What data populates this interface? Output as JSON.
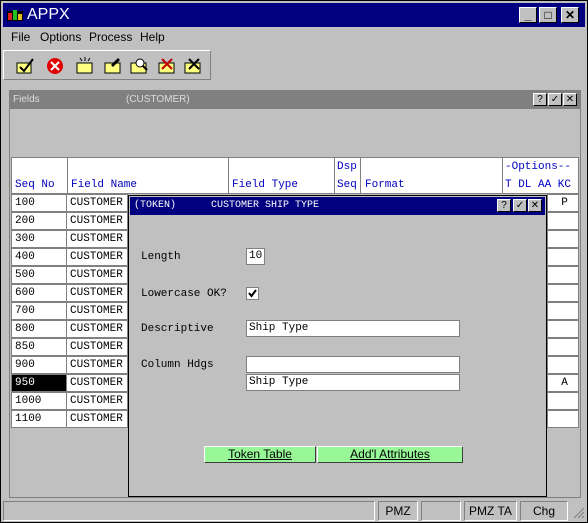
{
  "app": {
    "title": "APPX"
  },
  "menu": {
    "items": [
      "File",
      "Options",
      "Process",
      "Help"
    ]
  },
  "window_buttons": {
    "minimize": "_",
    "maximize": "□",
    "close": "✕"
  },
  "fields_window": {
    "title": "Fields",
    "subtitle": "(CUSTOMER)"
  },
  "table": {
    "headers": {
      "seq_no": "Seq No",
      "field_name": "Field Name",
      "field_type": "Field Type",
      "dsp": "Dsp",
      "seq": "Seq",
      "format": "Format",
      "options": "-Options--",
      "opt_cols": "T DL AA KC"
    },
    "rows": [
      {
        "seq": "100",
        "name": "CUSTOMER",
        "opt": "P"
      },
      {
        "seq": "200",
        "name": "CUSTOMER",
        "opt": ""
      },
      {
        "seq": "300",
        "name": "CUSTOMER",
        "opt": ""
      },
      {
        "seq": "400",
        "name": "CUSTOMER",
        "opt": ""
      },
      {
        "seq": "500",
        "name": "CUSTOMER",
        "opt": ""
      },
      {
        "seq": "600",
        "name": "CUSTOMER",
        "opt": ""
      },
      {
        "seq": "700",
        "name": "CUSTOMER",
        "opt": ""
      },
      {
        "seq": "800",
        "name": "CUSTOMER",
        "opt": ""
      },
      {
        "seq": "850",
        "name": "CUSTOMER",
        "opt": ""
      },
      {
        "seq": "900",
        "name": "CUSTOMER",
        "opt": ""
      },
      {
        "seq": "950",
        "name": "CUSTOMER",
        "opt": "A"
      },
      {
        "seq": "1000",
        "name": "CUSTOMER",
        "opt": ""
      },
      {
        "seq": "1100",
        "name": "CUSTOMER",
        "opt": ""
      }
    ]
  },
  "dialog": {
    "tag": "(TOKEN)",
    "title": "CUSTOMER SHIP TYPE",
    "length_label": "Length",
    "length_value": "10",
    "lowercase_label": "Lowercase OK?",
    "lowercase_checked": true,
    "descriptive_label": "Descriptive",
    "descriptive_value": "Ship Type",
    "column_hdgs_label": "Column Hdgs",
    "column_hdgs_line1": "",
    "column_hdgs_line2": "Ship Type",
    "token_table_button": "Token Table",
    "addl_attributes_button": "Add'l Attributes"
  },
  "status_bar": {
    "pmz": "PMZ",
    "pmz_ta": "PMZ TA",
    "chg": "Chg"
  },
  "colors": {
    "titlebar": "#000080",
    "header_text": "#0000c0",
    "green_button": "#98f898"
  }
}
